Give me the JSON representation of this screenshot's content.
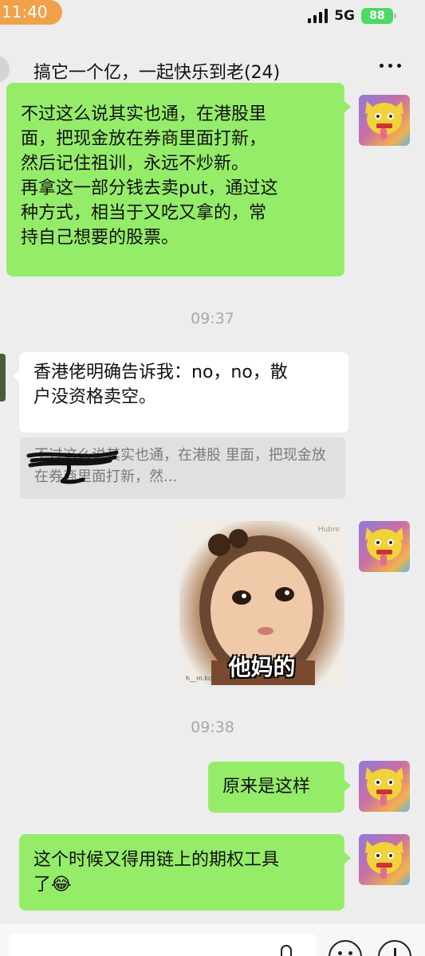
{
  "status_bar": {
    "time": "11:40",
    "network": "5G",
    "battery": "88"
  },
  "header": {
    "title": "搞它一个亿，一起快乐到老(24)"
  },
  "messages": [
    {
      "text": "不过这么说其实也通，在港股里\n面，把现金放在券商里面打新，\n然后记住祖训，永远不炒新。\n再拿这一部分钱去卖put，通过这\n种方式，相当于又吃又拿的，常\n持自己想要的股票。"
    },
    {
      "text": "香港佬明确告诉我：no，no，散\n户没资格卖空。",
      "quote": "不过这么说其实也通，在港股\n里面，把现金放在券商里面打新，然..."
    },
    {
      "sticker_caption": "他妈的",
      "watermark": "Hubre",
      "watermark2": "h__m.kct..."
    },
    {
      "text": "原来是这样"
    },
    {
      "text": "这个时候又得用链上的期权工具\n了😂"
    }
  ],
  "timestamps": [
    "09:37",
    "09:38"
  ],
  "colors": {
    "self_bubble": "#95ec69",
    "other_bubble": "#ffffff",
    "background": "#ededed",
    "time_pill": "#f0a14a"
  },
  "icons": [
    "signal-icon",
    "battery-icon",
    "back-icon",
    "more-icon",
    "voice-icon",
    "emoji-icon",
    "plus-icon"
  ]
}
